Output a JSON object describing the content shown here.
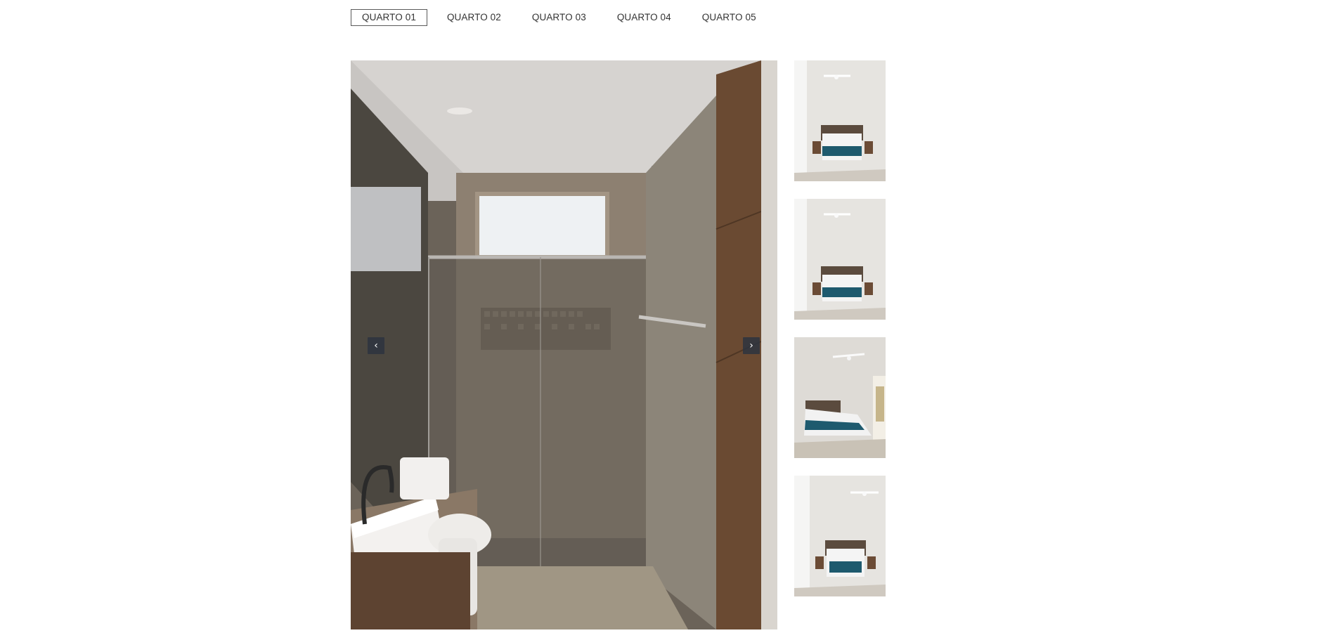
{
  "tabs": [
    {
      "label": "QUARTO 01",
      "active": true
    },
    {
      "label": "QUARTO 02",
      "active": false
    },
    {
      "label": "QUARTO 03",
      "active": false
    },
    {
      "label": "QUARTO 04",
      "active": false
    },
    {
      "label": "QUARTO 05",
      "active": false
    }
  ],
  "gallery": {
    "prev_icon": "chevron-left-icon",
    "next_icon": "chevron-right-icon",
    "prev_glyph": "‹",
    "next_glyph": "›",
    "main_image": "bathroom-shower-photo",
    "thumbnails": [
      {
        "image": "bedroom-photo"
      },
      {
        "image": "bedroom-photo"
      },
      {
        "image": "bedroom-photo"
      },
      {
        "image": "bedroom-photo"
      }
    ]
  },
  "colors": {
    "tab_border_active": "#5a5a5a",
    "nav_button_bg": "#2d3440"
  }
}
